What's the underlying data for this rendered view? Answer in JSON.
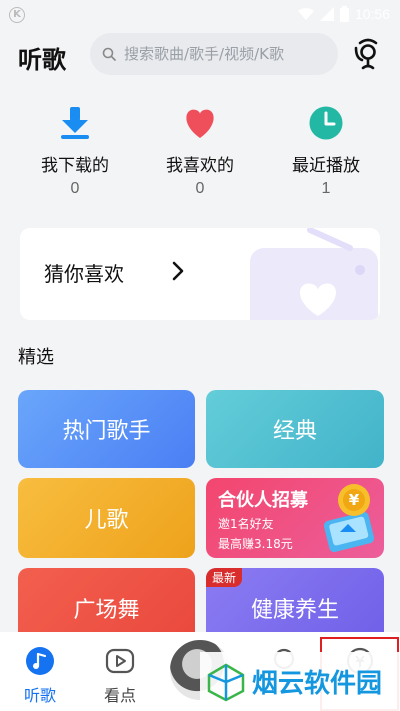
{
  "status": {
    "time": "10:56",
    "left_icon": "K"
  },
  "header": {
    "title": "听歌",
    "search_placeholder": "搜索歌曲/歌手/视频/K歌",
    "mic_icon": "voice-search-icon"
  },
  "quick": [
    {
      "label": "我下载的",
      "count": "0",
      "icon": "download-icon",
      "color": "#1a8df2"
    },
    {
      "label": "我喜欢的",
      "count": "0",
      "icon": "heart-icon",
      "color": "#ef4f5a"
    },
    {
      "label": "最近播放",
      "count": "1",
      "icon": "clock-icon",
      "color": "#23b8a4"
    }
  ],
  "guess": {
    "label": "猜你喜欢"
  },
  "section": {
    "title": "精选"
  },
  "tiles": {
    "hot": "热门歌手",
    "classic": "经典",
    "kids": "儿歌",
    "partner_title": "合伙人招募",
    "partner_sub1": "邀1名好友",
    "partner_sub2": "最高赚3.18元",
    "partner_coin": "¥",
    "dance": "广场舞",
    "health": "健康养生",
    "health_badge": "最新"
  },
  "tabs": [
    {
      "label": "听歌",
      "icon": "music-note-icon",
      "active": true
    },
    {
      "label": "看点",
      "icon": "video-play-icon",
      "active": false
    }
  ],
  "watermark": {
    "text": "烟云软件园"
  },
  "colors": {
    "accent": "#1572f0",
    "highlight": "#e02020"
  }
}
